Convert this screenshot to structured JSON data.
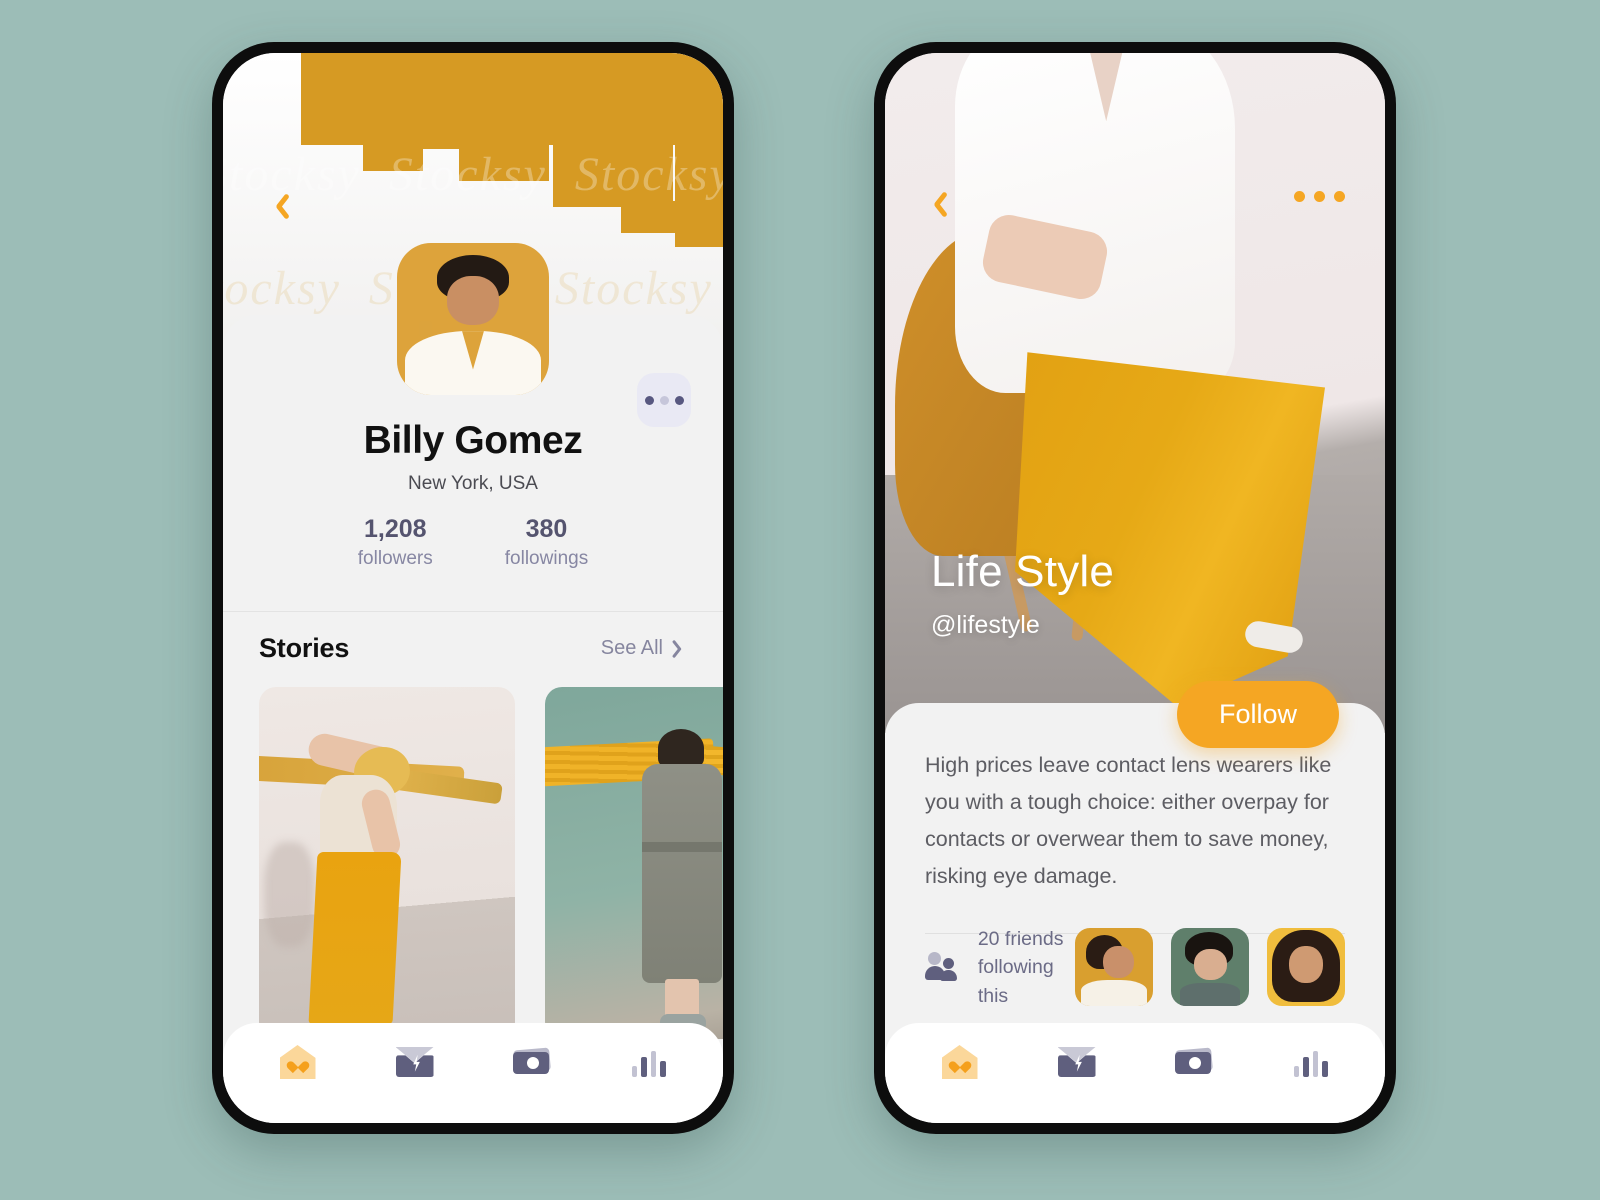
{
  "canvas": {
    "background_color": "#9cbdb7"
  },
  "theme": {
    "accent": "#f5a623",
    "ochre": "#d69a23",
    "slate": "#5f5f7e",
    "card_bg": "#f2f2f2"
  },
  "phone_profile": {
    "back_icon": "chevron-left-icon",
    "more_icon": "more-horizontal-icon",
    "profile": {
      "name": "Billy Gomez",
      "location": "New York, USA",
      "avatar_alt": "profile-photo",
      "stats": [
        {
          "value": "1,208",
          "label": "followers"
        },
        {
          "value": "380",
          "label": "followings"
        }
      ]
    },
    "stories": {
      "title": "Stories",
      "see_all_label": "See All",
      "see_all_icon": "chevron-right-icon",
      "items": [
        {
          "alt": "woman-pulling-yellow-rope"
        },
        {
          "alt": "woman-behind-yellow-fabric"
        }
      ]
    },
    "nav": [
      {
        "icon": "home-heart-icon",
        "active": true
      },
      {
        "icon": "mail-bolt-icon",
        "active": false
      },
      {
        "icon": "camera-icon",
        "active": false
      },
      {
        "icon": "bar-chart-icon",
        "active": false
      }
    ]
  },
  "phone_feed": {
    "back_icon": "chevron-left-icon",
    "more_icon": "more-horizontal-icon",
    "hero": {
      "title": "Life Style",
      "handle": "@lifestyle",
      "image_alt": "woman-in-yellow-culottes-on-chair"
    },
    "follow_button": "Follow",
    "body_text": "High prices leave contact lens wearers like you with a tough choice: either overpay for contacts or overwear them to save money, risking eye damage.",
    "friends": {
      "icon": "people-icon",
      "line1": "20 friends",
      "line2": "following this",
      "avatars": [
        {
          "alt": "friend-avatar-1"
        },
        {
          "alt": "friend-avatar-2"
        },
        {
          "alt": "friend-avatar-3"
        }
      ]
    },
    "nav": [
      {
        "icon": "home-heart-icon",
        "active": true
      },
      {
        "icon": "mail-bolt-icon",
        "active": false
      },
      {
        "icon": "camera-icon",
        "active": false
      },
      {
        "icon": "bar-chart-icon",
        "active": false
      }
    ]
  }
}
